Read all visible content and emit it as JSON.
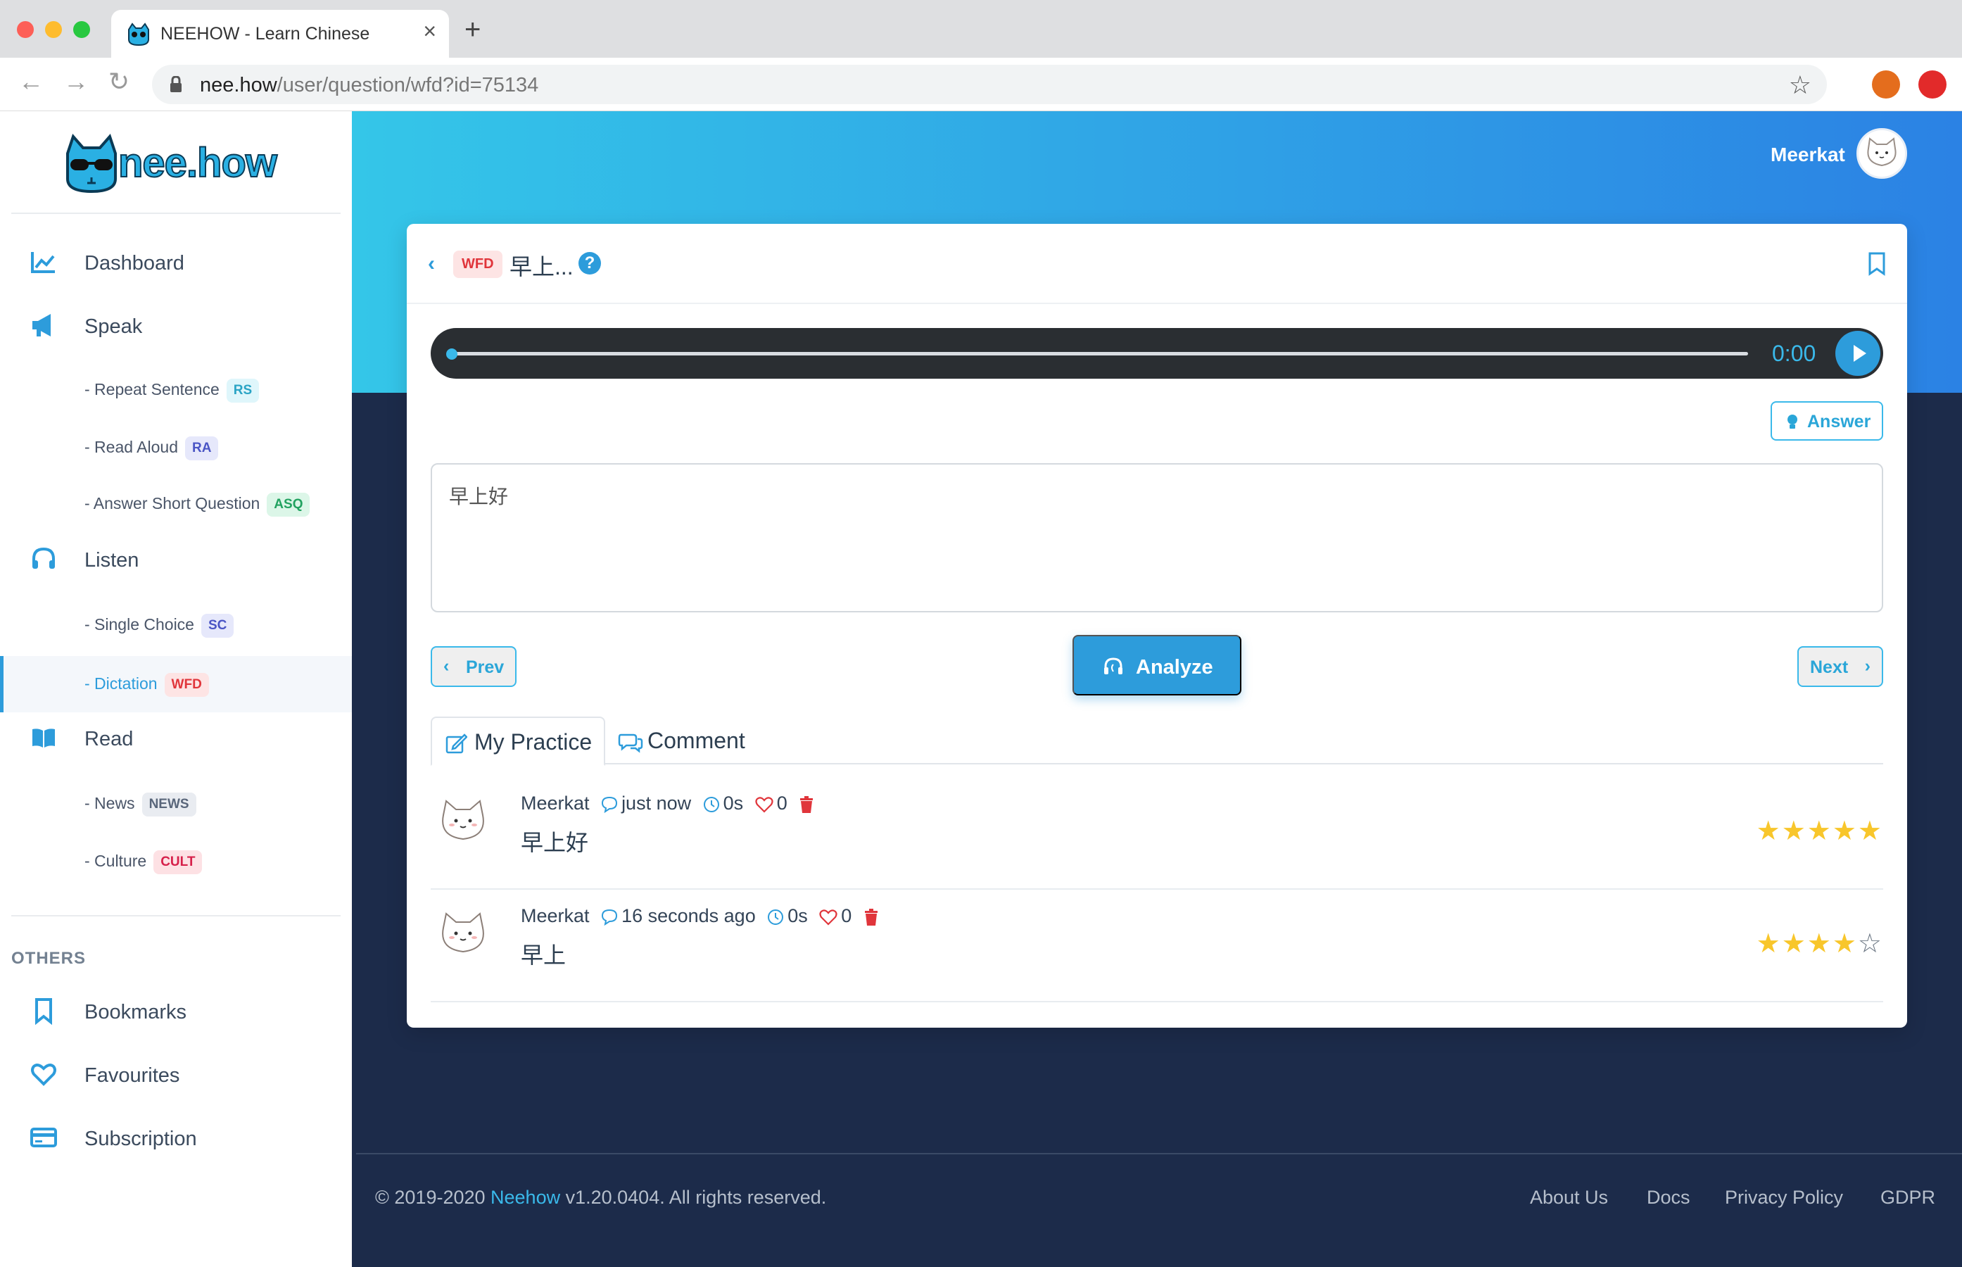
{
  "browser": {
    "tab_title": "NEEHOW - Learn Chinese",
    "url_host": "nee.how",
    "url_path": "/user/question/wfd?id=75134"
  },
  "sidebar": {
    "logo_text": "nee.how",
    "items": {
      "dashboard": "Dashboard",
      "speak": "Speak",
      "repeat_sentence": "- Repeat Sentence",
      "repeat_sentence_badge": "RS",
      "read_aloud": "- Read Aloud",
      "read_aloud_badge": "RA",
      "answer_short_question": "- Answer Short Question",
      "answer_short_question_badge": "ASQ",
      "listen": "Listen",
      "single_choice": "- Single Choice",
      "single_choice_badge": "SC",
      "dictation": "- Dictation",
      "dictation_badge": "WFD",
      "read": "Read",
      "news": "- News",
      "news_badge": "NEWS",
      "culture": "- Culture",
      "culture_badge": "CULT"
    },
    "others_heading": "OTHERS",
    "others": {
      "bookmarks": "Bookmarks",
      "favourites": "Favourites",
      "subscription": "Subscription"
    }
  },
  "header": {
    "user_name": "Meerkat"
  },
  "question": {
    "badge": "WFD",
    "title": "早上...",
    "help": "?"
  },
  "player": {
    "time": "0:00",
    "progress": 0
  },
  "answer_label": "Answer",
  "input": {
    "value": "早上好"
  },
  "controls": {
    "prev": "Prev",
    "analyze": "Analyze",
    "next": "Next"
  },
  "tabs": {
    "practice": "My Practice",
    "comment": "Comment"
  },
  "entries": [
    {
      "user": "Meerkat",
      "time": "just now",
      "duration": "0s",
      "likes": "0",
      "text": "早上好",
      "rating": 5
    },
    {
      "user": "Meerkat",
      "time": "16 seconds ago",
      "duration": "0s",
      "likes": "0",
      "text": "早上",
      "rating": 4
    }
  ],
  "footer": {
    "copyright_prefix": "© 2019-2020 ",
    "brand": "Neehow",
    "copyright_suffix": " v1.20.0404. All rights reserved.",
    "links": {
      "about": "About Us",
      "docs": "Docs",
      "privacy": "Privacy Policy",
      "gdpr": "GDPR"
    }
  },
  "colors": {
    "accent": "#2d9cdb",
    "hero_start": "#34c6e8",
    "hero_end": "#2b82e4",
    "dark_bg": "#1c2b4a",
    "star": "#f8c62b",
    "danger": "#e0353b"
  }
}
